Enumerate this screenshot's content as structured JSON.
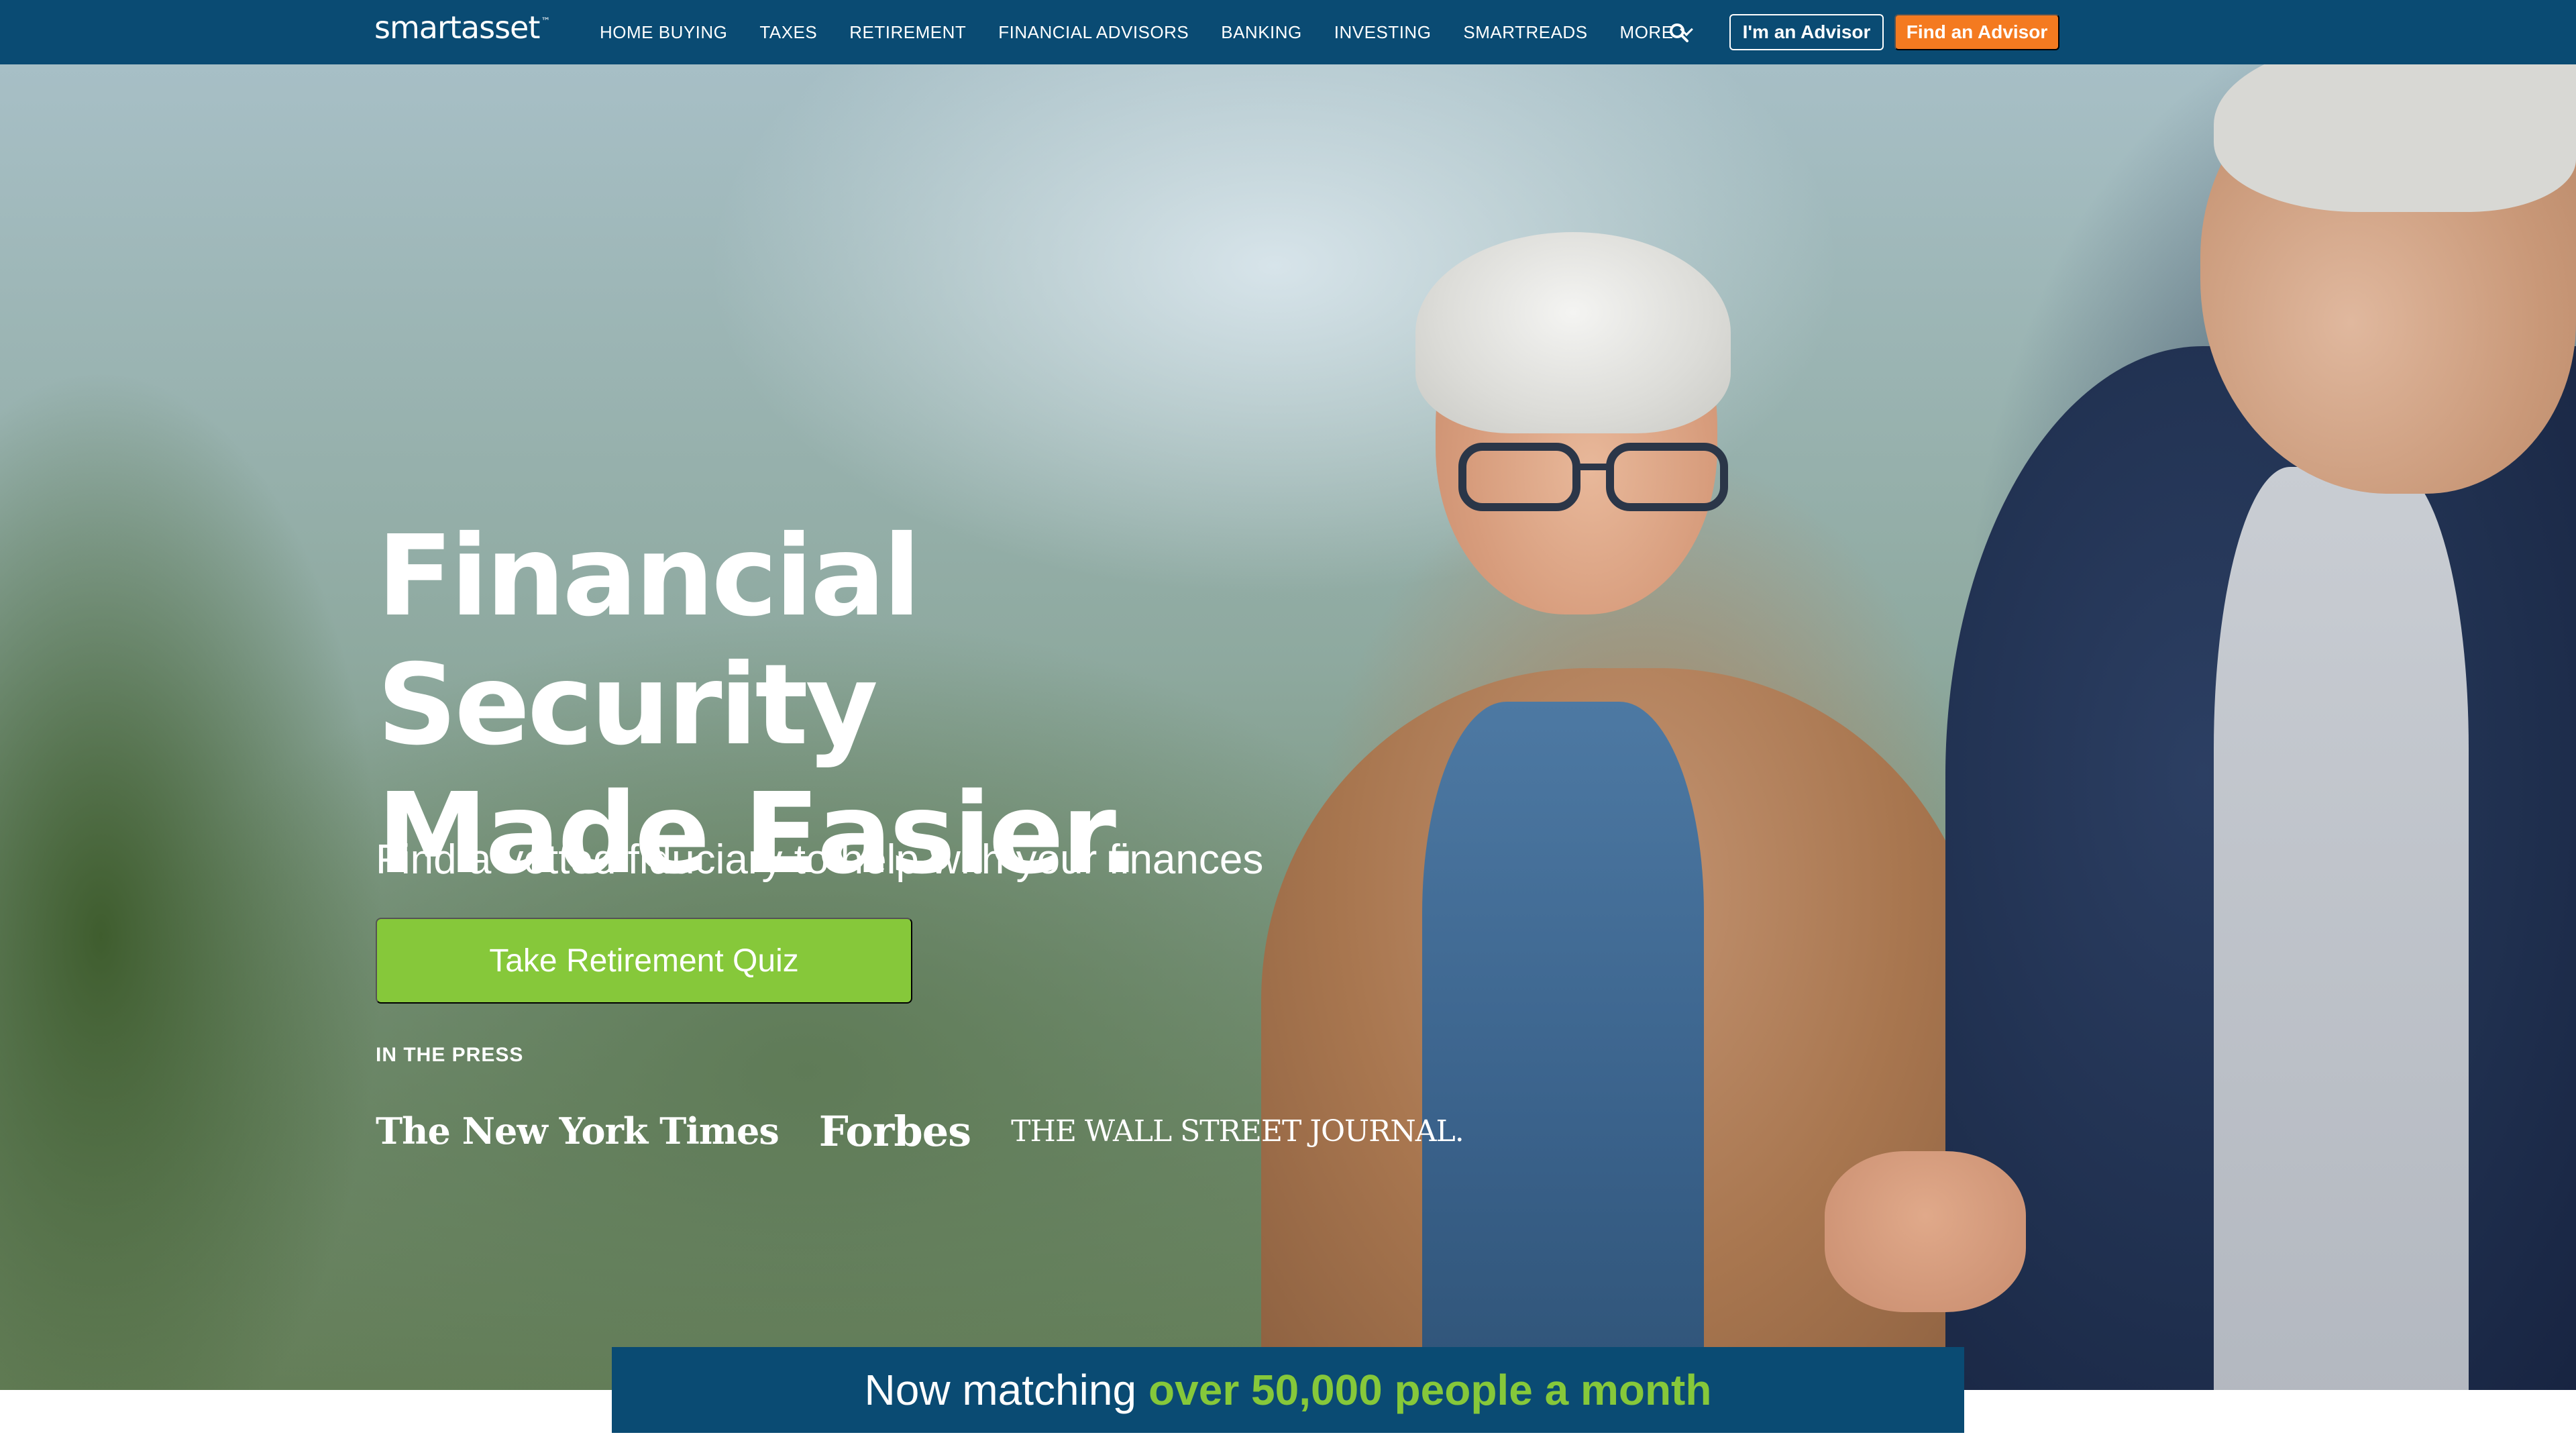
{
  "brand": {
    "logo": "smartasset",
    "trademark": "™",
    "colors": {
      "navy": "#0a4b73",
      "green": "#86c83a",
      "orange": "#f47a20"
    }
  },
  "nav": {
    "items": [
      {
        "label": "HOME BUYING"
      },
      {
        "label": "TAXES"
      },
      {
        "label": "RETIREMENT"
      },
      {
        "label": "FINANCIAL ADVISORS"
      },
      {
        "label": "BANKING"
      },
      {
        "label": "INVESTING"
      },
      {
        "label": "SMARTREADS"
      },
      {
        "label": "MORE"
      }
    ],
    "search_icon": "search-icon",
    "advisor_button": "I'm an Advisor",
    "find_button": "Find an Advisor"
  },
  "hero": {
    "title_line1": "Financial Security",
    "title_line2": "Made Easier.",
    "subtitle": "Find a vetted fiduciary to help with your finances",
    "cta": "Take Retirement Quiz",
    "press_label": "IN THE PRESS",
    "press": {
      "nyt": "The New York Times",
      "forbes": "Forbes",
      "wsj": "THE WALL STREET JOURNAL."
    }
  },
  "banner": {
    "prefix": "Now matching",
    "highlight": "over 50,000 people a month"
  }
}
